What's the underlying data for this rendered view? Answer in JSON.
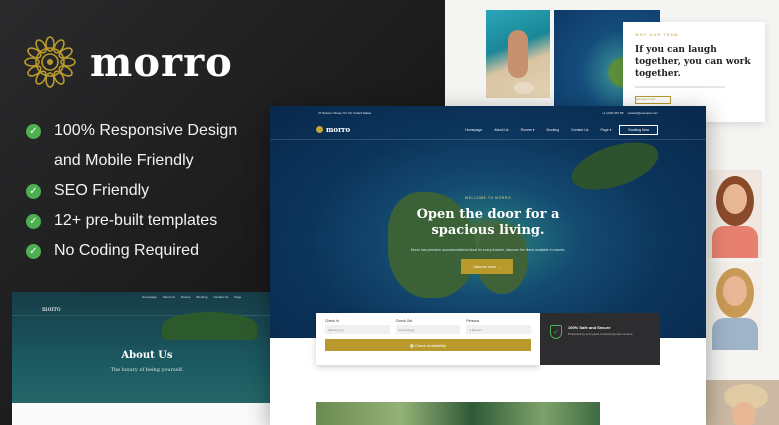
{
  "brand": {
    "name": "morro",
    "accent": "#b89a2c"
  },
  "features": [
    {
      "text": "100% Responsive Design",
      "check": true
    },
    {
      "text": "and Mobile Friendly",
      "check": false
    },
    {
      "text": "SEO Friendly",
      "check": true
    },
    {
      "text": "12+ pre-built templates",
      "check": true
    },
    {
      "text": "No Coding Required",
      "check": true
    }
  ],
  "check_glyph": "✓",
  "quote_card": {
    "eyebrow": "WHY OUR TEAM",
    "quote": "If you can laugh together, you can work together.",
    "button": "Discover more"
  },
  "mockup": {
    "topbar": {
      "address": "27 Division Street, NY 10, United States",
      "phone": "+1 (234) 567 89",
      "email": "contact@example.com"
    },
    "nav": {
      "logo": "morro",
      "links": [
        "Homepage",
        "About Us",
        "Rooms ▾",
        "Booking",
        "Contact Us",
        "Page ▾"
      ],
      "book_button": "Booking Now"
    },
    "hero": {
      "eyebrow": "WELCOME TO MORRO",
      "title": "Open the door for a spacious living.",
      "description": "Morro has premium accommodations ideal for every traveler, discover the finest available in resorts.",
      "button": "Discover more →"
    },
    "booking": {
      "check_in_label": "Check In",
      "check_in_value": "dd/mm/yyyy",
      "check_out_label": "Check Out",
      "check_out_value": "dd/mm/yyyy",
      "persons_label": "Persons",
      "persons_value": "1 Person",
      "cta": "▦ Check Availability"
    },
    "secure": {
      "title": "100% Safe and Secure",
      "text": "Protected by encrypted, trusted payment service."
    }
  },
  "about_shot": {
    "logo": "morro",
    "nav": [
      "Homepage",
      "About Us",
      "Rooms",
      "Booking",
      "Contact Us",
      "Page"
    ],
    "title": "About Us",
    "subtitle": "The luxury of being yourself."
  },
  "icons": [
    "sun-emblem-icon",
    "check-icon",
    "shield-icon",
    "calendar-icon"
  ]
}
